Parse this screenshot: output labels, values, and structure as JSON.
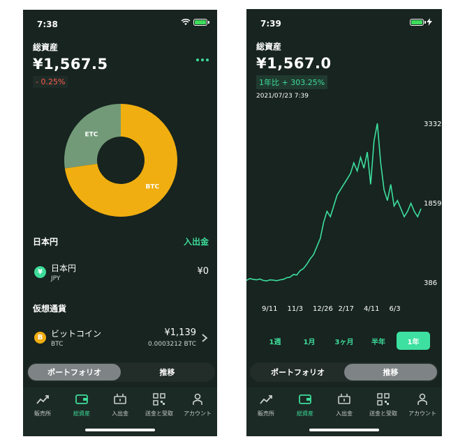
{
  "left": {
    "status_time": "7:38",
    "total_label": "総資産",
    "total_value": "¥1,567.5",
    "change": "- 0.25%",
    "donut": {
      "segments": [
        {
          "label": "BTC",
          "percent": 72.7,
          "color": "#f0ae10"
        },
        {
          "label": "ETC",
          "percent": 27.3,
          "color": "#729a78"
        }
      ]
    },
    "jpy_section_title": "日本円",
    "deposit_link": "入出金",
    "jpy_asset": {
      "name": "日本円",
      "code": "JPY",
      "amount": "¥0",
      "icon": "¥"
    },
    "crypto_section_title": "仮想通貨",
    "btc_asset": {
      "name": "ビットコイン",
      "code": "BTC",
      "amount": "¥1,139",
      "quantity": "0.0003212 BTC",
      "icon": "B"
    },
    "segment": {
      "portfolio": "ポートフォリオ",
      "trend": "推移",
      "active": "portfolio"
    }
  },
  "right": {
    "status_time": "7:39",
    "total_label": "総資産",
    "total_value": "¥1,567.0",
    "change": "1年比 + 303.25%",
    "datetime": "2021/07/23 7:39",
    "chart_data": {
      "type": "line",
      "y_ticks": [
        "3332",
        "1859",
        "386"
      ],
      "x_ticks": [
        "9/11",
        "11/3",
        "12/26",
        "2/17",
        "4/11",
        "6/3"
      ],
      "ylim": [
        386,
        3332
      ],
      "color": "#3de0a0",
      "series": [
        {
          "values": [
            420,
            455,
            440,
            430,
            445,
            420,
            410,
            430,
            425,
            415,
            430,
            440,
            470,
            480,
            530,
            520,
            600,
            640,
            720,
            820,
            900,
            1050,
            1200,
            1500,
            1700,
            1600,
            1800,
            2000,
            2100,
            2200,
            2300,
            2400,
            2600,
            2450,
            2700,
            2500,
            2800,
            2200,
            3000,
            3332,
            2600,
            2100,
            1900,
            2200,
            1800,
            1900,
            1750,
            1600,
            1700,
            1850,
            1700,
            1600,
            1750
          ]
        }
      ]
    },
    "periods": [
      "1週",
      "1月",
      "3ヶ月",
      "半年",
      "1年"
    ],
    "active_period": "1年",
    "segment": {
      "portfolio": "ポートフォリオ",
      "trend": "推移",
      "active": "trend"
    }
  },
  "tabs": [
    {
      "label": "販売所",
      "icon": "chart-up-icon"
    },
    {
      "label": "総資産",
      "icon": "wallet-icon"
    },
    {
      "label": "入出金",
      "icon": "transfer-icon"
    },
    {
      "label": "送金と受取",
      "icon": "qr-icon"
    },
    {
      "label": "アカウント",
      "icon": "person-icon"
    }
  ]
}
